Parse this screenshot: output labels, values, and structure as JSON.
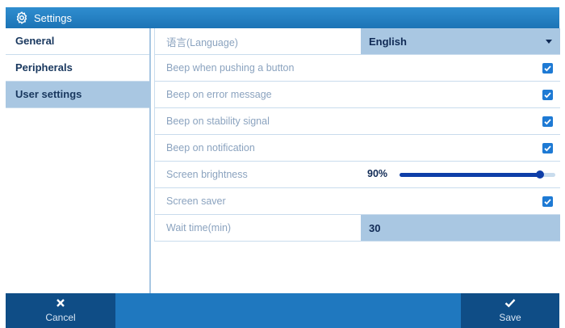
{
  "window": {
    "title": "Settings"
  },
  "sidebar": {
    "items": [
      {
        "label": "General"
      },
      {
        "label": "Peripherals"
      },
      {
        "label": "User settings"
      }
    ]
  },
  "settings": {
    "language": {
      "label": "语言(Language)",
      "value": "English"
    },
    "beep_button": {
      "label": "Beep when pushing a button",
      "checked": true
    },
    "beep_error": {
      "label": "Beep on error message",
      "checked": true
    },
    "beep_stability": {
      "label": "Beep on stability signal",
      "checked": true
    },
    "beep_notification": {
      "label": "Beep on notification",
      "checked": true
    },
    "brightness": {
      "label": "Screen brightness",
      "value_text": "90%",
      "value": 0.9
    },
    "screensaver": {
      "label": "Screen saver",
      "checked": true
    },
    "wait_time": {
      "label": "Wait time(min)",
      "value": "30"
    }
  },
  "footer": {
    "cancel_label": "Cancel",
    "save_label": "Save"
  },
  "colors": {
    "accent": "#1f78bf",
    "button_dark": "#0f4d86",
    "selected": "#a9c7e2",
    "slider": "#0e3ea8",
    "checkbox": "#1e7ad4"
  }
}
